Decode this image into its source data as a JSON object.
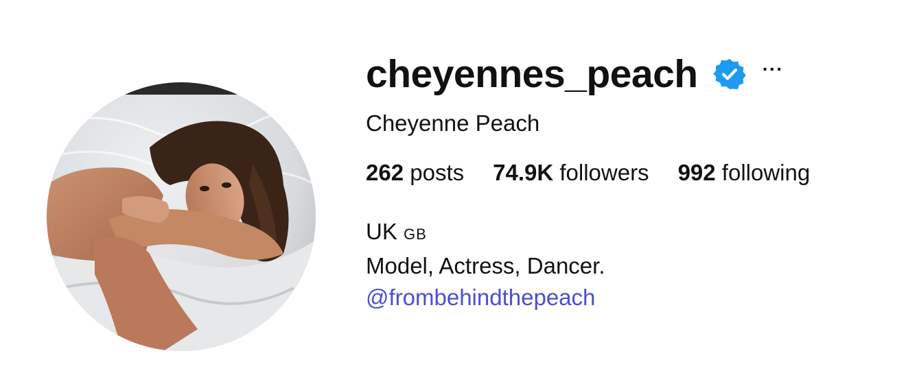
{
  "profile": {
    "username": "cheyennes_peach",
    "verified": true,
    "more_label": "···",
    "full_name": "Cheyenne Peach",
    "stats": {
      "posts": {
        "count": "262",
        "label": "posts"
      },
      "followers": {
        "count": "74.9K",
        "label": "followers"
      },
      "following": {
        "count": "992",
        "label": "following"
      }
    },
    "bio": {
      "location": "UK",
      "flag": "GB",
      "tagline": "Model, Actress, Dancer.",
      "mention": "@frombehindthepeach"
    }
  },
  "icons": {
    "verified": "verified-badge-icon",
    "more": "more-options-icon"
  },
  "colors": {
    "verified_badge": "#1d9bf0",
    "link": "#4a4fd1",
    "text": "#111111",
    "background": "#ffffff"
  }
}
